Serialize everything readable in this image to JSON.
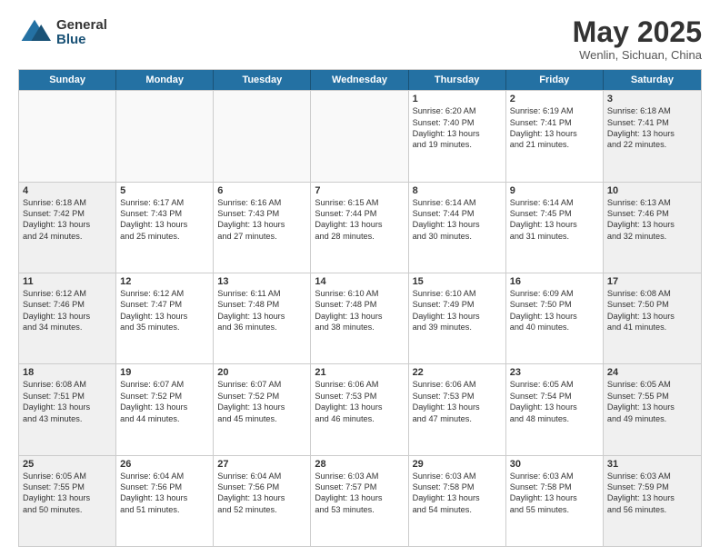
{
  "header": {
    "logo_general": "General",
    "logo_blue": "Blue",
    "month_year": "May 2025",
    "location": "Wenlin, Sichuan, China"
  },
  "days_of_week": [
    "Sunday",
    "Monday",
    "Tuesday",
    "Wednesday",
    "Thursday",
    "Friday",
    "Saturday"
  ],
  "rows": [
    {
      "cells": [
        {
          "day": "",
          "empty": true
        },
        {
          "day": "",
          "empty": true
        },
        {
          "day": "",
          "empty": true
        },
        {
          "day": "",
          "empty": true
        },
        {
          "day": "1",
          "sunrise": "Sunrise: 6:20 AM",
          "sunset": "Sunset: 7:40 PM",
          "daylight": "Daylight: 13 hours",
          "extra": "and 19 minutes."
        },
        {
          "day": "2",
          "sunrise": "Sunrise: 6:19 AM",
          "sunset": "Sunset: 7:41 PM",
          "daylight": "Daylight: 13 hours",
          "extra": "and 21 minutes."
        },
        {
          "day": "3",
          "sunrise": "Sunrise: 6:18 AM",
          "sunset": "Sunset: 7:41 PM",
          "daylight": "Daylight: 13 hours",
          "extra": "and 22 minutes."
        }
      ]
    },
    {
      "cells": [
        {
          "day": "4",
          "sunrise": "Sunrise: 6:18 AM",
          "sunset": "Sunset: 7:42 PM",
          "daylight": "Daylight: 13 hours",
          "extra": "and 24 minutes."
        },
        {
          "day": "5",
          "sunrise": "Sunrise: 6:17 AM",
          "sunset": "Sunset: 7:43 PM",
          "daylight": "Daylight: 13 hours",
          "extra": "and 25 minutes."
        },
        {
          "day": "6",
          "sunrise": "Sunrise: 6:16 AM",
          "sunset": "Sunset: 7:43 PM",
          "daylight": "Daylight: 13 hours",
          "extra": "and 27 minutes."
        },
        {
          "day": "7",
          "sunrise": "Sunrise: 6:15 AM",
          "sunset": "Sunset: 7:44 PM",
          "daylight": "Daylight: 13 hours",
          "extra": "and 28 minutes."
        },
        {
          "day": "8",
          "sunrise": "Sunrise: 6:14 AM",
          "sunset": "Sunset: 7:44 PM",
          "daylight": "Daylight: 13 hours",
          "extra": "and 30 minutes."
        },
        {
          "day": "9",
          "sunrise": "Sunrise: 6:14 AM",
          "sunset": "Sunset: 7:45 PM",
          "daylight": "Daylight: 13 hours",
          "extra": "and 31 minutes."
        },
        {
          "day": "10",
          "sunrise": "Sunrise: 6:13 AM",
          "sunset": "Sunset: 7:46 PM",
          "daylight": "Daylight: 13 hours",
          "extra": "and 32 minutes."
        }
      ]
    },
    {
      "cells": [
        {
          "day": "11",
          "sunrise": "Sunrise: 6:12 AM",
          "sunset": "Sunset: 7:46 PM",
          "daylight": "Daylight: 13 hours",
          "extra": "and 34 minutes."
        },
        {
          "day": "12",
          "sunrise": "Sunrise: 6:12 AM",
          "sunset": "Sunset: 7:47 PM",
          "daylight": "Daylight: 13 hours",
          "extra": "and 35 minutes."
        },
        {
          "day": "13",
          "sunrise": "Sunrise: 6:11 AM",
          "sunset": "Sunset: 7:48 PM",
          "daylight": "Daylight: 13 hours",
          "extra": "and 36 minutes."
        },
        {
          "day": "14",
          "sunrise": "Sunrise: 6:10 AM",
          "sunset": "Sunset: 7:48 PM",
          "daylight": "Daylight: 13 hours",
          "extra": "and 38 minutes."
        },
        {
          "day": "15",
          "sunrise": "Sunrise: 6:10 AM",
          "sunset": "Sunset: 7:49 PM",
          "daylight": "Daylight: 13 hours",
          "extra": "and 39 minutes."
        },
        {
          "day": "16",
          "sunrise": "Sunrise: 6:09 AM",
          "sunset": "Sunset: 7:50 PM",
          "daylight": "Daylight: 13 hours",
          "extra": "and 40 minutes."
        },
        {
          "day": "17",
          "sunrise": "Sunrise: 6:08 AM",
          "sunset": "Sunset: 7:50 PM",
          "daylight": "Daylight: 13 hours",
          "extra": "and 41 minutes."
        }
      ]
    },
    {
      "cells": [
        {
          "day": "18",
          "sunrise": "Sunrise: 6:08 AM",
          "sunset": "Sunset: 7:51 PM",
          "daylight": "Daylight: 13 hours",
          "extra": "and 43 minutes."
        },
        {
          "day": "19",
          "sunrise": "Sunrise: 6:07 AM",
          "sunset": "Sunset: 7:52 PM",
          "daylight": "Daylight: 13 hours",
          "extra": "and 44 minutes."
        },
        {
          "day": "20",
          "sunrise": "Sunrise: 6:07 AM",
          "sunset": "Sunset: 7:52 PM",
          "daylight": "Daylight: 13 hours",
          "extra": "and 45 minutes."
        },
        {
          "day": "21",
          "sunrise": "Sunrise: 6:06 AM",
          "sunset": "Sunset: 7:53 PM",
          "daylight": "Daylight: 13 hours",
          "extra": "and 46 minutes."
        },
        {
          "day": "22",
          "sunrise": "Sunrise: 6:06 AM",
          "sunset": "Sunset: 7:53 PM",
          "daylight": "Daylight: 13 hours",
          "extra": "and 47 minutes."
        },
        {
          "day": "23",
          "sunrise": "Sunrise: 6:05 AM",
          "sunset": "Sunset: 7:54 PM",
          "daylight": "Daylight: 13 hours",
          "extra": "and 48 minutes."
        },
        {
          "day": "24",
          "sunrise": "Sunrise: 6:05 AM",
          "sunset": "Sunset: 7:55 PM",
          "daylight": "Daylight: 13 hours",
          "extra": "and 49 minutes."
        }
      ]
    },
    {
      "cells": [
        {
          "day": "25",
          "sunrise": "Sunrise: 6:05 AM",
          "sunset": "Sunset: 7:55 PM",
          "daylight": "Daylight: 13 hours",
          "extra": "and 50 minutes."
        },
        {
          "day": "26",
          "sunrise": "Sunrise: 6:04 AM",
          "sunset": "Sunset: 7:56 PM",
          "daylight": "Daylight: 13 hours",
          "extra": "and 51 minutes."
        },
        {
          "day": "27",
          "sunrise": "Sunrise: 6:04 AM",
          "sunset": "Sunset: 7:56 PM",
          "daylight": "Daylight: 13 hours",
          "extra": "and 52 minutes."
        },
        {
          "day": "28",
          "sunrise": "Sunrise: 6:03 AM",
          "sunset": "Sunset: 7:57 PM",
          "daylight": "Daylight: 13 hours",
          "extra": "and 53 minutes."
        },
        {
          "day": "29",
          "sunrise": "Sunrise: 6:03 AM",
          "sunset": "Sunset: 7:58 PM",
          "daylight": "Daylight: 13 hours",
          "extra": "and 54 minutes."
        },
        {
          "day": "30",
          "sunrise": "Sunrise: 6:03 AM",
          "sunset": "Sunset: 7:58 PM",
          "daylight": "Daylight: 13 hours",
          "extra": "and 55 minutes."
        },
        {
          "day": "31",
          "sunrise": "Sunrise: 6:03 AM",
          "sunset": "Sunset: 7:59 PM",
          "daylight": "Daylight: 13 hours",
          "extra": "and 56 minutes."
        }
      ]
    }
  ]
}
